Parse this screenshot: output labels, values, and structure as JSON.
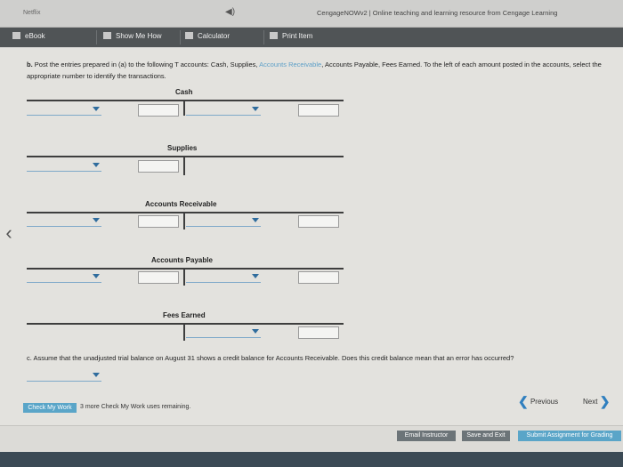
{
  "browser": {
    "tab_left": "Netflix",
    "tab_right": "CengageNOWv2 | Online teaching and learning resource from Cengage Learning"
  },
  "toolbar": {
    "ebook": "eBook",
    "show_me_how": "Show Me How",
    "calculator": "Calculator",
    "print_item": "Print Item"
  },
  "instructions": {
    "prefix": "b.",
    "text_before": "Post the entries prepared in (a) to the following T accounts: Cash, Supplies,",
    "accent_text": "Accounts Receivable",
    "text_after": ", Accounts Payable, Fees Earned. To the left of each amount posted in the accounts, select the appropriate number to identify the transactions."
  },
  "accounts": [
    "Cash",
    "Supplies",
    "Accounts Receivable",
    "Accounts Payable",
    "Fees Earned"
  ],
  "question_c": "c. Assume that the unadjusted trial balance on August 31 shows a credit balance for Accounts Receivable. Does this credit balance mean that an error has occurred?",
  "footer": {
    "check_my_work": "Check My Work",
    "remaining": "3 more Check My Work uses remaining.",
    "previous": "Previous",
    "next": "Next",
    "email_instructor": "Email Instructor",
    "save_and_exit": "Save and Exit",
    "submit": "Submit Assignment for Grading"
  }
}
